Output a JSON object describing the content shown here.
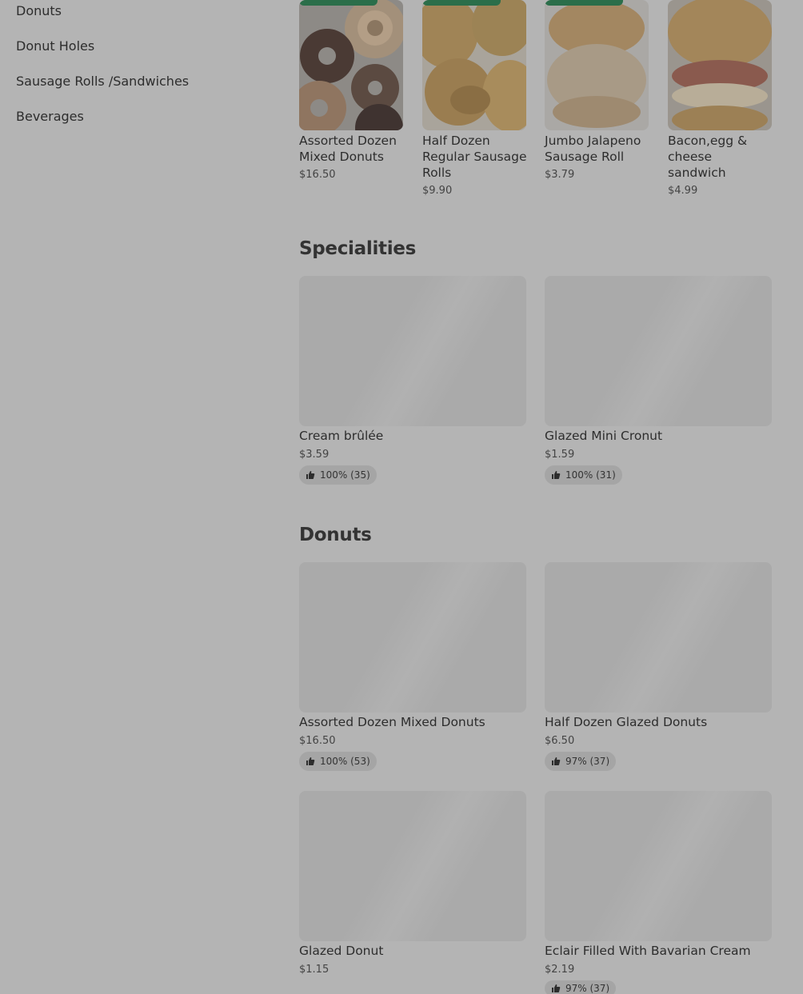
{
  "sidebar": {
    "items": [
      {
        "label": "Donuts"
      },
      {
        "label": "Donut Holes"
      },
      {
        "label": "Sausage Rolls /Sandwiches"
      },
      {
        "label": "Beverages"
      }
    ]
  },
  "featured": {
    "items": [
      {
        "title": "Assorted Dozen Mixed Donuts",
        "price": "$16.50",
        "icon": "donut-image"
      },
      {
        "title": "Half Dozen Regular Sausage Rolls",
        "price": "$9.90",
        "icon": "sausage-roll-image"
      },
      {
        "title": "Jumbo Jalapeno Sausage Roll",
        "price": "$3.79",
        "icon": "sausage-roll-image"
      },
      {
        "title": "Bacon,egg & cheese sandwich",
        "price": "$4.99",
        "icon": "sandwich-image"
      }
    ]
  },
  "specialities": {
    "title": "Specialities",
    "items": [
      {
        "title": "Cream brûlée",
        "price": "$3.59",
        "rating": "100% (35)"
      },
      {
        "title": "Glazed Mini Cronut",
        "price": "$1.59",
        "rating": "100% (31)"
      }
    ]
  },
  "donuts": {
    "title": "Donuts",
    "items": [
      {
        "title": "Assorted Dozen Mixed Donuts",
        "price": "$16.50",
        "rating": "100% (53)"
      },
      {
        "title": "Half Dozen Glazed Donuts",
        "price": "$6.50",
        "rating": "97% (37)"
      },
      {
        "title": "Glazed Donut",
        "price": "$1.15",
        "rating": ""
      },
      {
        "title": "Eclair Filled With Bavarian Cream",
        "price": "$2.19",
        "rating": "97% (37)"
      }
    ]
  },
  "colors": {
    "overlay_background": "#b4b4b4",
    "badge_green": "#2b6e4a"
  }
}
